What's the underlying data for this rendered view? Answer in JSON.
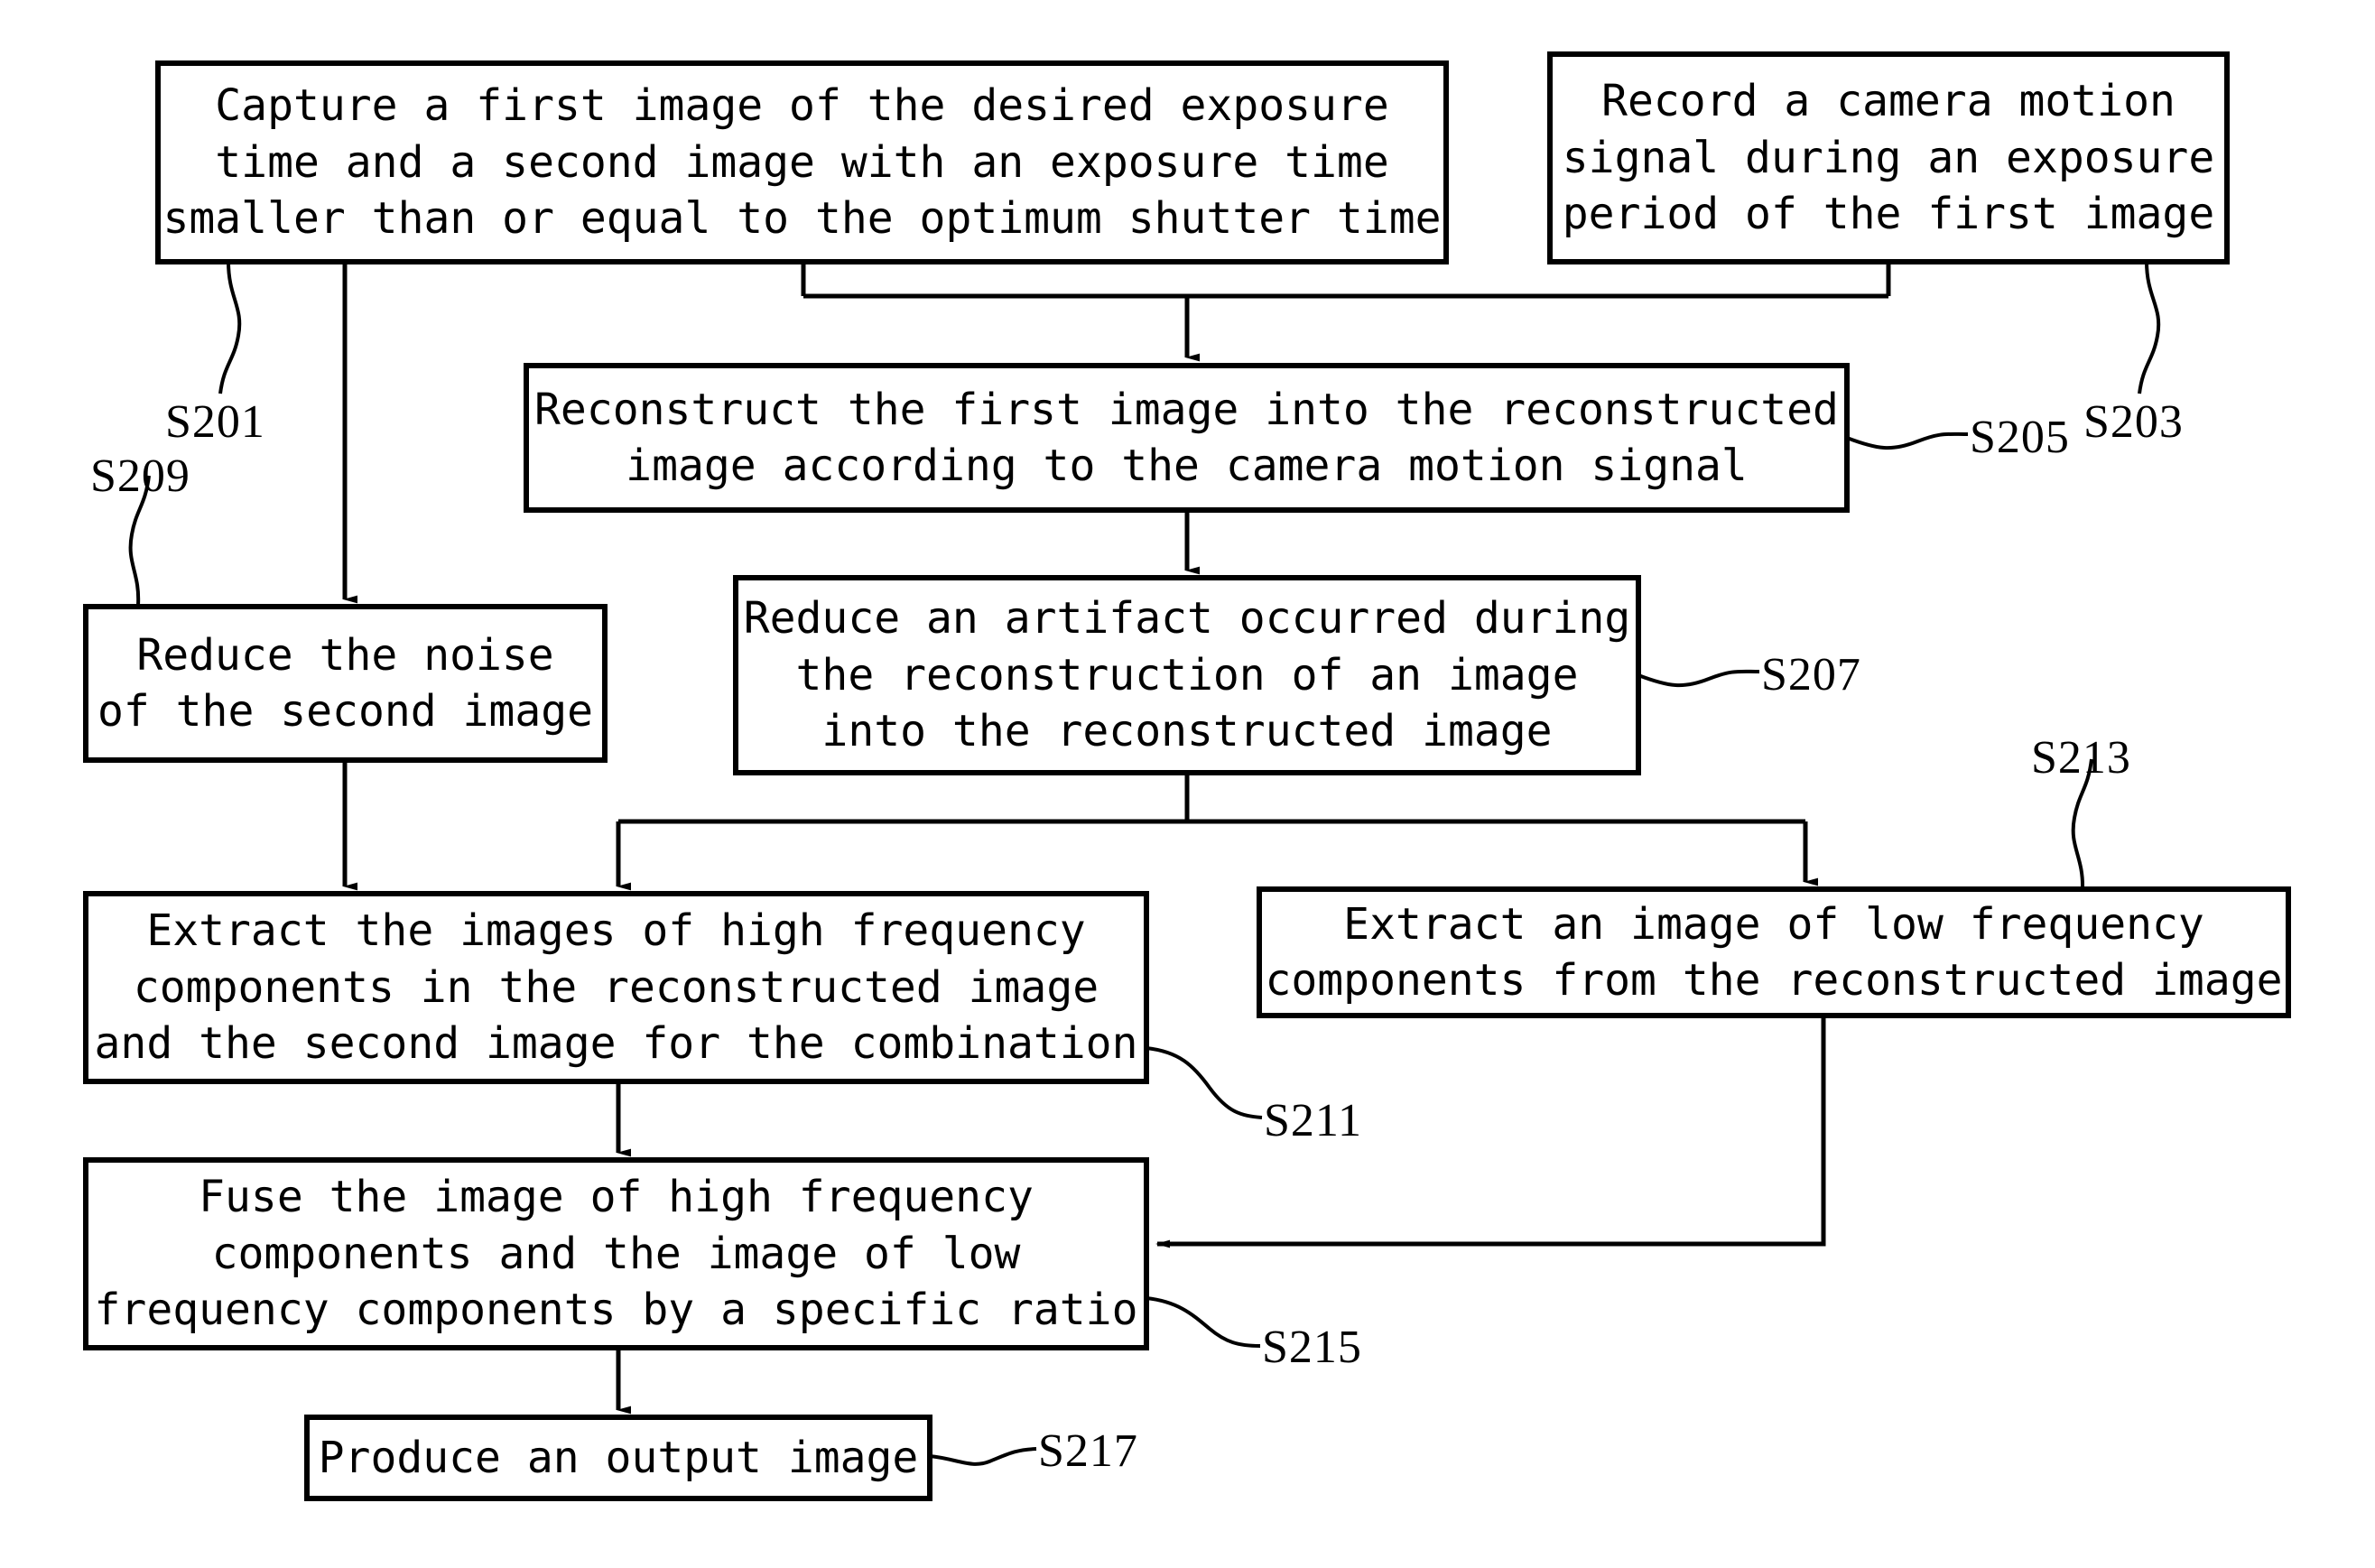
{
  "diagram": {
    "title": "Image processing flowchart",
    "stroke_color": "#000000",
    "background_color": "#ffffff",
    "boxes": [
      {
        "id": "s201",
        "step": "S201",
        "lines": [
          "Capture a first image of the desired exposure",
          "time and a second image with an exposure time",
          "smaller than or equal to the optimum shutter time"
        ]
      },
      {
        "id": "s203",
        "step": "S203",
        "lines": [
          "Record a camera motion",
          "signal during an exposure",
          "period of the first image"
        ]
      },
      {
        "id": "s205",
        "step": "S205",
        "lines": [
          "Reconstruct the first image into the reconstructed",
          "image according to the camera motion signal"
        ]
      },
      {
        "id": "s207",
        "step": "S207",
        "lines": [
          "Reduce an artifact occurred during",
          "the reconstruction of an image",
          "into the reconstructed image"
        ]
      },
      {
        "id": "s209",
        "step": "S209",
        "lines": [
          "Reduce the noise",
          "of the second image"
        ]
      },
      {
        "id": "s211",
        "step": "S211",
        "lines": [
          "Extract the images of high frequency",
          "components in the reconstructed image",
          "and the second image for the combination"
        ]
      },
      {
        "id": "s213",
        "step": "S213",
        "lines": [
          "Extract an image of low frequency",
          "components from the reconstructed image"
        ]
      },
      {
        "id": "s215",
        "step": "S215",
        "lines": [
          "Fuse the image of high frequency",
          "components and the image of low",
          "frequency components by a specific ratio"
        ]
      },
      {
        "id": "s217",
        "step": "S217",
        "lines": [
          "Produce an output image"
        ]
      }
    ],
    "step_labels": [
      {
        "id": "label-s201",
        "text": "S201"
      },
      {
        "id": "label-s203",
        "text": "S203"
      },
      {
        "id": "label-s205",
        "text": "S205"
      },
      {
        "id": "label-s207",
        "text": "S207"
      },
      {
        "id": "label-s209",
        "text": "S209"
      },
      {
        "id": "label-s211",
        "text": "S211"
      },
      {
        "id": "label-s213",
        "text": "S213"
      },
      {
        "id": "label-s215",
        "text": "S215"
      },
      {
        "id": "label-s217",
        "text": "S217"
      }
    ]
  }
}
